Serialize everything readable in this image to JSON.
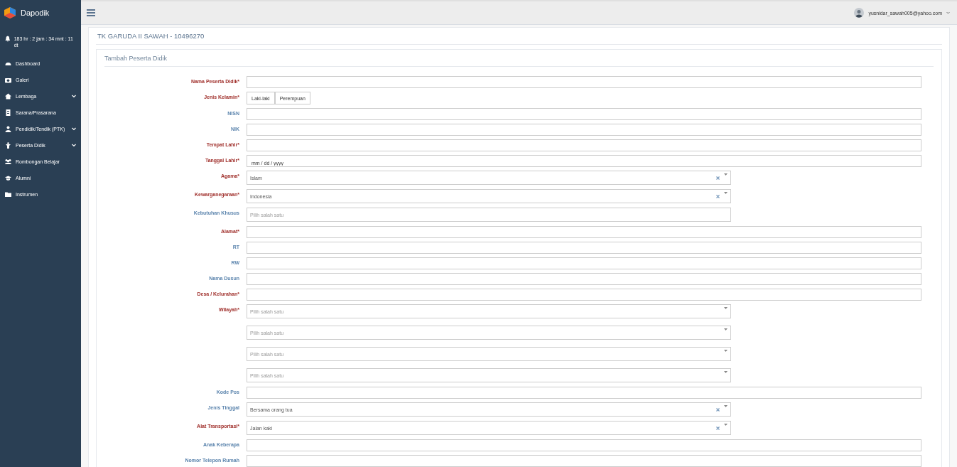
{
  "sidebar": {
    "brand": "Dapodik",
    "timer": "183 hr : 2 jam : 34 mnt : 11 dt",
    "items": [
      {
        "label": "Dashboard",
        "expandable": false
      },
      {
        "label": "Galeri",
        "expandable": false
      },
      {
        "label": "Lembaga",
        "expandable": true
      },
      {
        "label": "Sarana/Prasarana",
        "expandable": false
      },
      {
        "label": "Pendidik/Tendik (PTK)",
        "expandable": true
      },
      {
        "label": "Peserta Didik",
        "expandable": true
      },
      {
        "label": "Rombongan Belajar",
        "expandable": false
      },
      {
        "label": "Alumni",
        "expandable": false
      },
      {
        "label": "Instrumen",
        "expandable": false
      }
    ]
  },
  "topbar": {
    "user_email": "yusnidar_sawah005@yahoo.com"
  },
  "panel": {
    "title": "TK GARUDA II SAWAH - 10496270",
    "form_title": "Tambah Peserta Didik"
  },
  "fields": [
    {
      "label": "Nama Peserta Didik*",
      "required": true,
      "kind": "text"
    },
    {
      "label": "Jenis Kelamin*",
      "required": true,
      "kind": "toggle",
      "options": [
        {
          "label": "Laki-laki",
          "selected": false
        },
        {
          "label": "Perempuan",
          "selected": false
        }
      ]
    },
    {
      "label": "NISN",
      "required": false,
      "kind": "text"
    },
    {
      "label": "NIK",
      "required": false,
      "kind": "text"
    },
    {
      "label": "Tempat Lahir*",
      "required": true,
      "kind": "text"
    },
    {
      "label": "Tanggal Lahir*",
      "required": true,
      "kind": "date",
      "placeholder": "mm / dd / yyyy"
    },
    {
      "label": "Agama*",
      "required": true,
      "kind": "select",
      "selects": [
        {
          "value": "Islam",
          "clearable": true
        }
      ]
    },
    {
      "label": "Kewarganegaraan*",
      "required": true,
      "kind": "select",
      "selects": [
        {
          "value": "Indonesia",
          "clearable": true
        }
      ]
    },
    {
      "label": "Kebutuhan Khusus",
      "required": false,
      "kind": "select",
      "selects": [
        {
          "placeholder": "Pilih salah satu",
          "clearable": false,
          "arrow": false
        }
      ]
    },
    {
      "label": "Alamat*",
      "required": true,
      "kind": "text"
    },
    {
      "label": "RT",
      "required": false,
      "kind": "text"
    },
    {
      "label": "RW",
      "required": false,
      "kind": "text"
    },
    {
      "label": "Nama Dusun",
      "required": false,
      "kind": "text"
    },
    {
      "label": "Desa / Kelurahan*",
      "required": true,
      "kind": "text"
    },
    {
      "label": "Wilayah*",
      "required": true,
      "kind": "select",
      "selects": [
        {
          "placeholder": "Pilih salah satu",
          "clearable": false
        },
        {
          "placeholder": "Pilih salah satu",
          "clearable": false
        },
        {
          "placeholder": "Pilih salah satu",
          "clearable": false
        },
        {
          "placeholder": "Pilih salah satu",
          "clearable": false
        }
      ]
    },
    {
      "label": "Kode Pos",
      "required": false,
      "kind": "text"
    },
    {
      "label": "Jenis Tinggal",
      "required": false,
      "kind": "select",
      "selects": [
        {
          "value": "Bersama orang tua",
          "clearable": true
        }
      ]
    },
    {
      "label": "Alat Transportasi*",
      "required": true,
      "kind": "select",
      "selects": [
        {
          "value": "Jalan kaki",
          "clearable": true
        }
      ]
    },
    {
      "label": "Anak Keberapa",
      "required": false,
      "kind": "text"
    },
    {
      "label": "Nomor Telepon Rumah",
      "required": false,
      "kind": "text"
    }
  ]
}
